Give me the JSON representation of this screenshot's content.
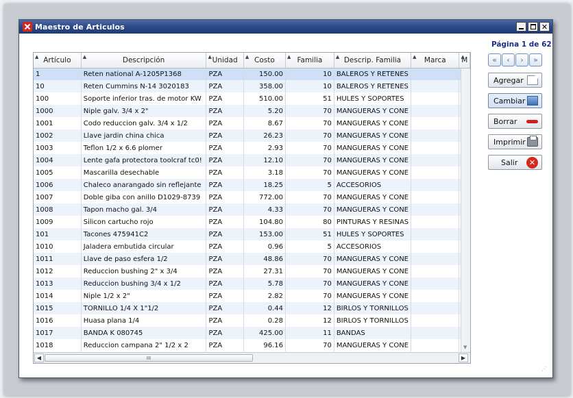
{
  "window": {
    "title": "Maestro de Articulos"
  },
  "pager": {
    "label": "Página 1 de 62",
    "buttons": [
      "first",
      "prev",
      "next",
      "last"
    ]
  },
  "actions": {
    "add": "Agregar",
    "edit": "Cambiar",
    "delete": "Borrar",
    "print": "Imprimir",
    "exit": "Salir"
  },
  "grid": {
    "columns": [
      "Artículo",
      "Descripción",
      "Unidad",
      "Costo",
      "Familia",
      "Descrip. Familia",
      "Marca",
      "M"
    ],
    "selected_row": 0,
    "rows": [
      [
        "1",
        "Reten national A-1205P1368",
        "PZA",
        "150.00",
        "10",
        "BALEROS Y RETENES",
        ""
      ],
      [
        "10",
        "Reten Cummins N-14 3020183",
        "PZA",
        "358.00",
        "10",
        "BALEROS Y RETENES",
        ""
      ],
      [
        "100",
        "Soporte inferior tras. de motor KW",
        "PZA",
        "510.00",
        "51",
        "HULES Y SOPORTES",
        ""
      ],
      [
        "1000",
        "Niple galv. 3/4 x 2\"",
        "PZA",
        "5.20",
        "70",
        "MANGUERAS Y CONE",
        ""
      ],
      [
        "1001",
        "Codo reduccion galv. 3/4 x 1/2",
        "PZA",
        "8.67",
        "70",
        "MANGUERAS Y CONE",
        ""
      ],
      [
        "1002",
        "Llave jardin china chica",
        "PZA",
        "26.23",
        "70",
        "MANGUERAS Y CONE",
        ""
      ],
      [
        "1003",
        "Teflon 1/2 x 6.6 plomer",
        "PZA",
        "2.93",
        "70",
        "MANGUERAS Y CONE",
        ""
      ],
      [
        "1004",
        "Lente gafa protectora toolcraf tc0!",
        "PZA",
        "12.10",
        "70",
        "MANGUERAS Y CONE",
        ""
      ],
      [
        "1005",
        "Mascarilla desechable",
        "PZA",
        "3.18",
        "70",
        "MANGUERAS Y CONE",
        ""
      ],
      [
        "1006",
        "Chaleco anarangado sin reflejante",
        "PZA",
        "18.25",
        "5",
        "ACCESORIOS",
        ""
      ],
      [
        "1007",
        "Doble giba con anillo D1029-8739",
        "PZA",
        "772.00",
        "70",
        "MANGUERAS Y CONE",
        ""
      ],
      [
        "1008",
        "Tapon macho gal. 3/4",
        "PZA",
        "4.33",
        "70",
        "MANGUERAS Y CONE",
        ""
      ],
      [
        "1009",
        "Silicon cartucho rojo",
        "PZA",
        "104.80",
        "80",
        "PINTURAS Y RESINAS",
        ""
      ],
      [
        "101",
        "Tacones 475941C2",
        "PZA",
        "153.00",
        "51",
        "HULES Y SOPORTES",
        ""
      ],
      [
        "1010",
        "Jaladera embutida circular",
        "PZA",
        "0.96",
        "5",
        "ACCESORIOS",
        ""
      ],
      [
        "1011",
        "Llave de paso esfera 1/2",
        "PZA",
        "48.86",
        "70",
        "MANGUERAS Y CONE",
        ""
      ],
      [
        "1012",
        "Reduccion bushing 2\" x 3/4",
        "PZA",
        "27.31",
        "70",
        "MANGUERAS Y CONE",
        ""
      ],
      [
        "1013",
        "Reduccion bushing 3/4 x 1/2",
        "PZA",
        "5.78",
        "70",
        "MANGUERAS Y CONE",
        ""
      ],
      [
        "1014",
        "Niple 1/2 x 2\"",
        "PZA",
        "2.82",
        "70",
        "MANGUERAS Y CONE",
        ""
      ],
      [
        "1015",
        "TORNILLO 1/4 X 1\"1/2",
        "PZA",
        "0.44",
        "12",
        "BIRLOS Y TORNILLOS",
        ""
      ],
      [
        "1016",
        "Huasa plana 1/4",
        "PZA",
        "0.28",
        "12",
        "BIRLOS Y TORNILLOS",
        ""
      ],
      [
        "1017",
        "BANDA K 080745",
        "PZA",
        "425.00",
        "11",
        "BANDAS",
        ""
      ],
      [
        "1018",
        "Reduccion campana 2\" 1/2 x 2",
        "PZA",
        "96.16",
        "70",
        "MANGUERAS Y CONE",
        ""
      ]
    ]
  },
  "scrollbar": {
    "thumb_label": "III"
  }
}
